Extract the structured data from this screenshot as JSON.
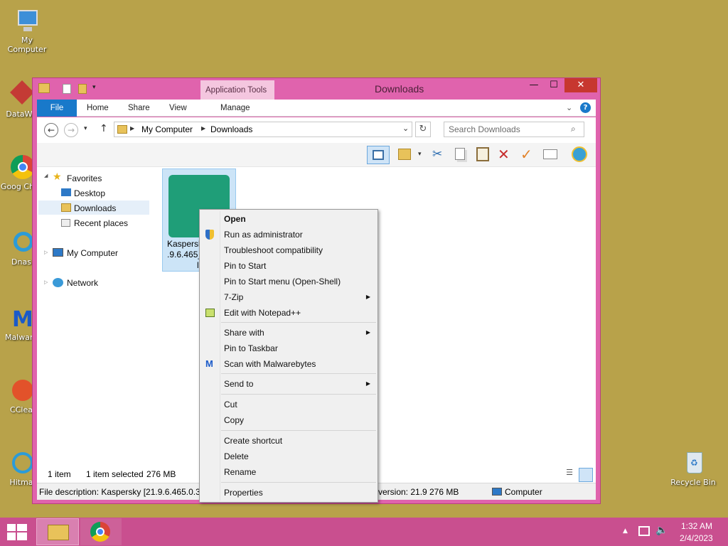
{
  "desktop": {
    "icons": [
      {
        "label": "My Computer"
      },
      {
        "label": "DataWa"
      },
      {
        "label": "Goog Chro"
      },
      {
        "label": "Dnas"
      },
      {
        "label": "Malware"
      },
      {
        "label": "CClea"
      },
      {
        "label": "Hitma"
      },
      {
        "label": "Recycle Bin"
      }
    ]
  },
  "window": {
    "title": "Downloads",
    "app_tools": "Application Tools",
    "tabs": {
      "file": "File",
      "home": "Home",
      "share": "Share",
      "view": "View",
      "manage": "Manage"
    },
    "address": {
      "crumb1": "My Computer",
      "crumb2": "Downloads"
    },
    "search_placeholder": "Search Downloads",
    "nav": {
      "favorites": "Favorites",
      "desktop": "Desktop",
      "downloads": "Downloads",
      "recent": "Recent places",
      "computer": "My Computer",
      "network": "Network"
    },
    "file": {
      "line1": "Kaspersk",
      "line2": ".9.6.465_",
      "line3": "l"
    },
    "status": {
      "items": "1 item",
      "selected": "1 item selected",
      "size": "276 MB"
    },
    "desc": {
      "left": "File description: Kaspersky [21.9.6.465.0.356",
      "version": "version: 21.9",
      "size": "276 MB",
      "location": "Computer"
    }
  },
  "context_menu": {
    "open": "Open",
    "run_admin": "Run as administrator",
    "troubleshoot": "Troubleshoot compatibility",
    "pin_start": "Pin to Start",
    "pin_start_menu": "Pin to Start menu (Open-Shell)",
    "seven_zip": "7-Zip",
    "edit_npp": "Edit with Notepad++",
    "share_with": "Share with",
    "pin_taskbar": "Pin to Taskbar",
    "scan_mb": "Scan with Malwarebytes",
    "send_to": "Send to",
    "cut": "Cut",
    "copy": "Copy",
    "create_shortcut": "Create shortcut",
    "delete": "Delete",
    "rename": "Rename",
    "properties": "Properties"
  },
  "taskbar": {
    "time": "1:32 AM",
    "date": "2/4/2023"
  }
}
